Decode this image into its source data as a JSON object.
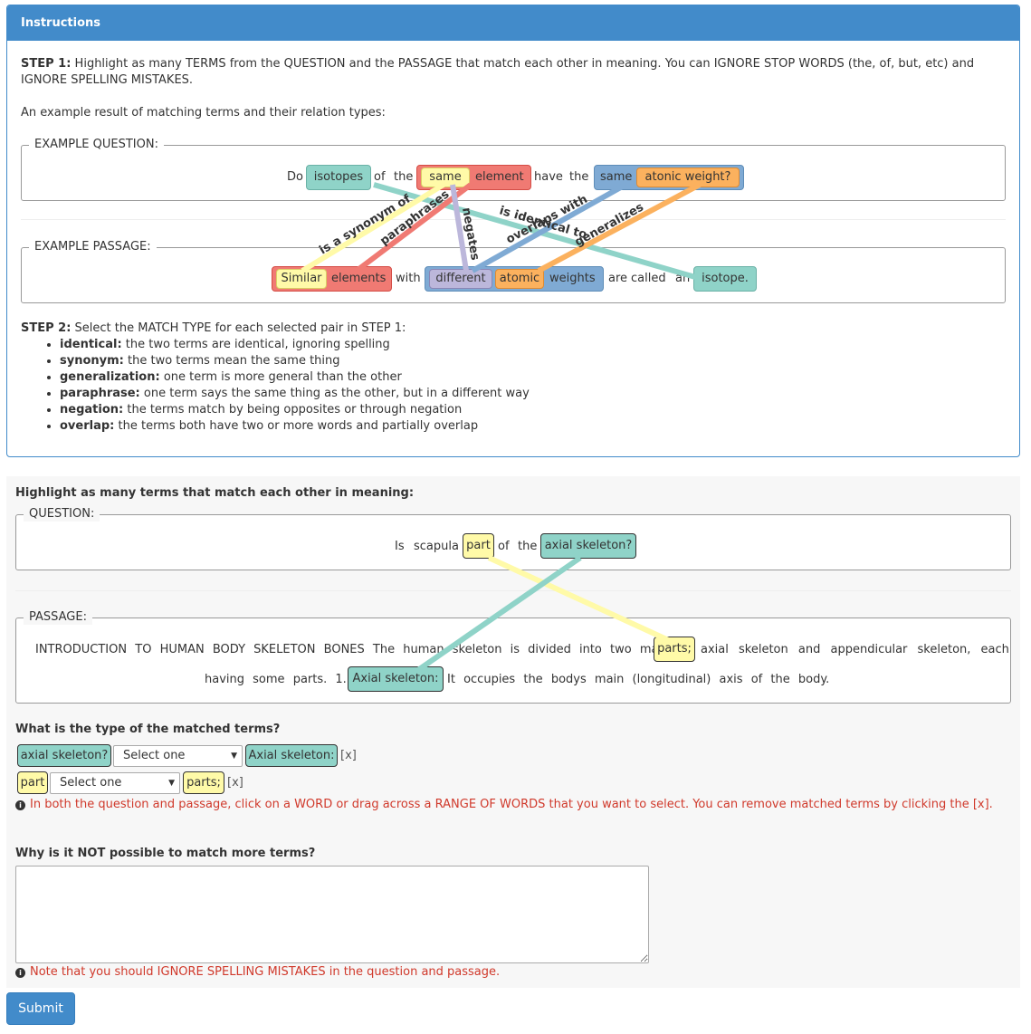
{
  "instructions": {
    "heading": "Instructions",
    "step1_label": "STEP 1:",
    "step1_text": " Highlight as many TERMS from the QUESTION and the PASSAGE that match each other in meaning. You can IGNORE STOP WORDS (the, of, but, etc) and IGNORE SPELLING MISTAKES.",
    "example_intro": "An example result of matching terms and their relation types:",
    "example_question_legend": "EXAMPLE QUESTION:",
    "example_passage_legend": "EXAMPLE PASSAGE:",
    "example_question": {
      "do": "Do",
      "isotopes": "isotopes",
      "of": "of",
      "the": "the",
      "same": "same",
      "element": "element",
      "have": "have",
      "the2": "the",
      "same2": "same",
      "atonic_weight": "atonic  weight?"
    },
    "example_passage": {
      "similar": "Similar",
      "elements": "elements",
      "with": "with",
      "different": "different",
      "atomic": "atomic",
      "weights": "weights",
      "are": "are",
      "called": "called",
      "an": "an",
      "isotope": "isotope."
    },
    "relations": {
      "synonym": "is a synonym of",
      "paraphrases": "paraphrases",
      "negates": "negates",
      "identical": "is identical to",
      "overlaps": "overlaps with",
      "generalizes": "generalizes"
    },
    "step2_label": "STEP 2:",
    "step2_text": " Select the MATCH TYPE for each selected pair in STEP 1:",
    "types": [
      {
        "name": "identical:",
        "desc": " the two terms are identical, ignoring spelling"
      },
      {
        "name": "synonym:",
        "desc": " the two terms mean the same thing"
      },
      {
        "name": "generalization:",
        "desc": " one term is more general than the other"
      },
      {
        "name": "paraphrase:",
        "desc": " one term says the same thing as the other, but in a different way"
      },
      {
        "name": "negation:",
        "desc": " the terms match by being opposites or through negation"
      },
      {
        "name": "overlap:",
        "desc": " the terms both have two or more words and partially overlap"
      }
    ]
  },
  "task": {
    "title": "Highlight as many terms that match each other in meaning:",
    "question_legend": "QUESTION:",
    "passage_legend": "PASSAGE:",
    "question": {
      "is": "Is",
      "scapula": "scapula",
      "part": "part",
      "of": "of",
      "the": "the",
      "axial_skeleton": "axial  skeleton?"
    },
    "passage_line1": [
      "INTRODUCTION",
      "TO",
      "HUMAN",
      "BODY",
      "SKELETON",
      "BONES",
      "The",
      "human",
      "skeleton",
      "is",
      "divided",
      "into",
      "two",
      "main"
    ],
    "passage_hl1": "parts;",
    "passage_line1b": [
      "axial",
      "skeleton",
      "and",
      "appendicular",
      "skeleton,",
      "each"
    ],
    "passage_line2a": [
      "having",
      "some",
      "parts.",
      "1."
    ],
    "passage_hl2": "Axial  skeleton:",
    "passage_line2b": [
      "It",
      "occupies",
      "the",
      "bodys",
      "main",
      "(longitudinal)",
      "axis",
      "of",
      "the",
      "body."
    ],
    "match_type_title": "What is the type of the matched terms?",
    "matches": [
      {
        "q": "axial skeleton?",
        "select": "Select one",
        "p": "Axial skeleton:",
        "remove": "[x]"
      },
      {
        "q": "part",
        "select": "Select one",
        "p": "parts;",
        "remove": "[x]"
      }
    ],
    "help_text": "In both the question and passage, click on a WORD or drag across a RANGE OF WORDS that you want to select. You can remove matched terms by clicking the [x].",
    "why_title": "Why is it NOT possible to match more terms?",
    "why_value": "",
    "note_text": "Note that you should IGNORE SPELLING MISTAKES in the question and passage.",
    "submit_label": "Submit"
  },
  "colors": {
    "primary": "#428bca",
    "teal": "#8fd3c8",
    "red": "#f07a73",
    "yellow": "#fffaa8",
    "blue": "#7faad4",
    "orange": "#fbb15e",
    "lavender": "#bcb7db",
    "error": "#d0392b"
  }
}
